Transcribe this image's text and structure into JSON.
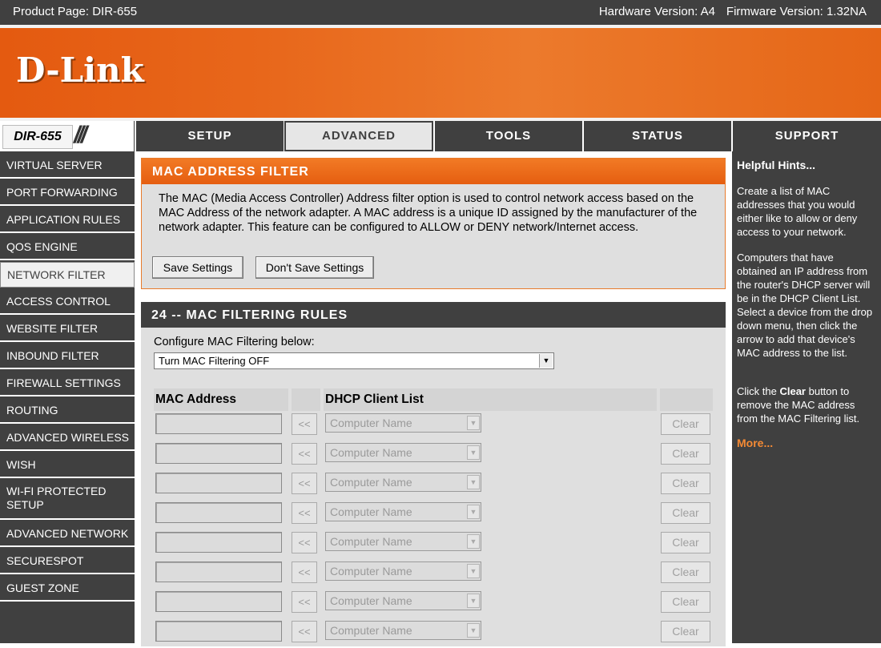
{
  "topbar": {
    "product": "Product Page: DIR-655",
    "hardware": "Hardware Version: A4",
    "firmware": "Firmware Version: 1.32NA"
  },
  "brand": {
    "logo": "D-Link",
    "model": "DIR-655",
    "accent": "#e8671b",
    "dark": "#404040"
  },
  "nav": {
    "tabs": [
      {
        "label": "SETUP"
      },
      {
        "label": "ADVANCED"
      },
      {
        "label": "TOOLS"
      },
      {
        "label": "STATUS"
      },
      {
        "label": "SUPPORT"
      }
    ],
    "active": "ADVANCED"
  },
  "sidebar": {
    "items": [
      {
        "label": "VIRTUAL SERVER"
      },
      {
        "label": "PORT FORWARDING"
      },
      {
        "label": "APPLICATION RULES"
      },
      {
        "label": "QOS ENGINE"
      },
      {
        "label": "NETWORK FILTER"
      },
      {
        "label": "ACCESS CONTROL"
      },
      {
        "label": "WEBSITE FILTER"
      },
      {
        "label": "INBOUND FILTER"
      },
      {
        "label": "FIREWALL SETTINGS"
      },
      {
        "label": "ROUTING"
      },
      {
        "label": "ADVANCED WIRELESS"
      },
      {
        "label": "WISH"
      },
      {
        "label": "WI-FI PROTECTED SETUP"
      },
      {
        "label": "ADVANCED NETWORK"
      },
      {
        "label": "SECURESPOT"
      },
      {
        "label": "GUEST ZONE"
      }
    ],
    "active": "NETWORK FILTER"
  },
  "filter": {
    "title": "MAC ADDRESS FILTER",
    "description": "The MAC (Media Access Controller) Address filter option is used to control network access based on the MAC Address of the network adapter. A MAC address is a unique ID assigned by the manufacturer of the network adapter. This feature can be configured to ALLOW or DENY network/Internet access.",
    "save_label": "Save Settings",
    "dont_save_label": "Don't Save Settings"
  },
  "rules": {
    "title": "24 -- MAC FILTERING RULES",
    "configure_label": "Configure MAC Filtering below:",
    "mode_value": "Turn MAC Filtering OFF",
    "col_mac": "MAC Address",
    "col_dhcp": "DHCP Client List",
    "arrow_label": "<<",
    "computer_placeholder": "Computer Name",
    "clear_label": "Clear",
    "visible_rows": 8
  },
  "hints": {
    "title": "Helpful Hints...",
    "p1": "Create a list of MAC addresses that you would either like to allow or deny access to your network.",
    "p2": "Computers that have obtained an IP address from the router's DHCP server will be in the DHCP Client List. Select a device from the drop down menu, then click the arrow to add that device's MAC address to the list.",
    "p3_pre": "Click the ",
    "p3_bold": "Clear",
    "p3_post": " button to remove the MAC address from the MAC Filtering list.",
    "more": "More..."
  }
}
